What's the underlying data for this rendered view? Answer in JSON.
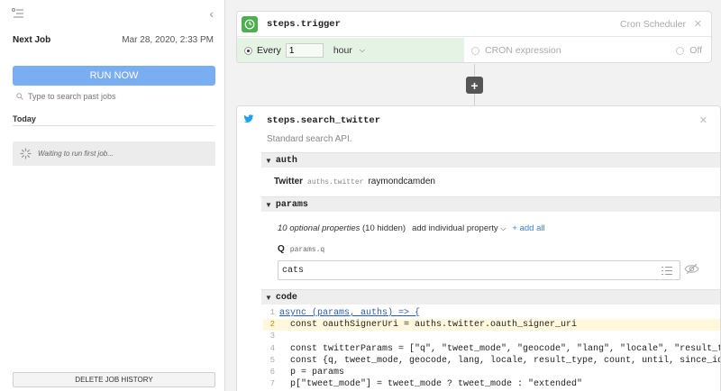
{
  "sidebar": {
    "next_job_label": "Next Job",
    "next_job_date": "Mar 28, 2020, 2:33 PM",
    "run_now_label": "RUN NOW",
    "search_placeholder": "Type to search past jobs",
    "today_label": "Today",
    "waiting_text": "Waiting to run first job...",
    "delete_history_label": "DELETE JOB HISTORY"
  },
  "trigger": {
    "step_name": "steps.trigger",
    "source_label": "Cron Scheduler",
    "every_label": "Every",
    "every_value": "1",
    "unit_label": "hour",
    "cron_label": "CRON expression",
    "off_label": "Off"
  },
  "step2": {
    "name": "steps.search_twitter",
    "description": "Standard search API.",
    "auth": {
      "section_label": "auth",
      "app_label": "Twitter",
      "key_label": "auths.twitter",
      "account": "raymondcamden"
    },
    "params": {
      "section_label": "params",
      "optional_count": "10 optional properties",
      "hidden_count": "(10 hidden)",
      "add_property_label": "add individual property",
      "add_all_label": "+ add all",
      "q_label": "Q",
      "q_key": "params.q",
      "q_value": "cats"
    },
    "code": {
      "section_label": "code",
      "lines": [
        {
          "n": "1",
          "text": "async (params, auths) => {"
        },
        {
          "n": "2",
          "text": "  const oauthSignerUri = auths.twitter.oauth_signer_uri"
        },
        {
          "n": "3",
          "text": ""
        },
        {
          "n": "4",
          "text": "  const twitterParams = [\"q\", \"tweet_mode\", \"geocode\", \"lang\", \"locale\", \"result_type\", \""
        },
        {
          "n": "5",
          "text": "  const {q, tweet_mode, geocode, lang, locale, result_type, count, until, since_id, max_i"
        },
        {
          "n": "6",
          "text": "  p = params"
        },
        {
          "n": "7",
          "text": "  p[\"tweet_mode\"] = tweet_mode ? tweet_mode : \"extended\""
        }
      ]
    }
  },
  "colors": {
    "accent": "#7aaef2",
    "trigger_green": "#4caf50",
    "trigger_bg": "#e4f3e4",
    "link_blue": "#3b7fd6",
    "twitter_blue": "#1da1f2"
  }
}
